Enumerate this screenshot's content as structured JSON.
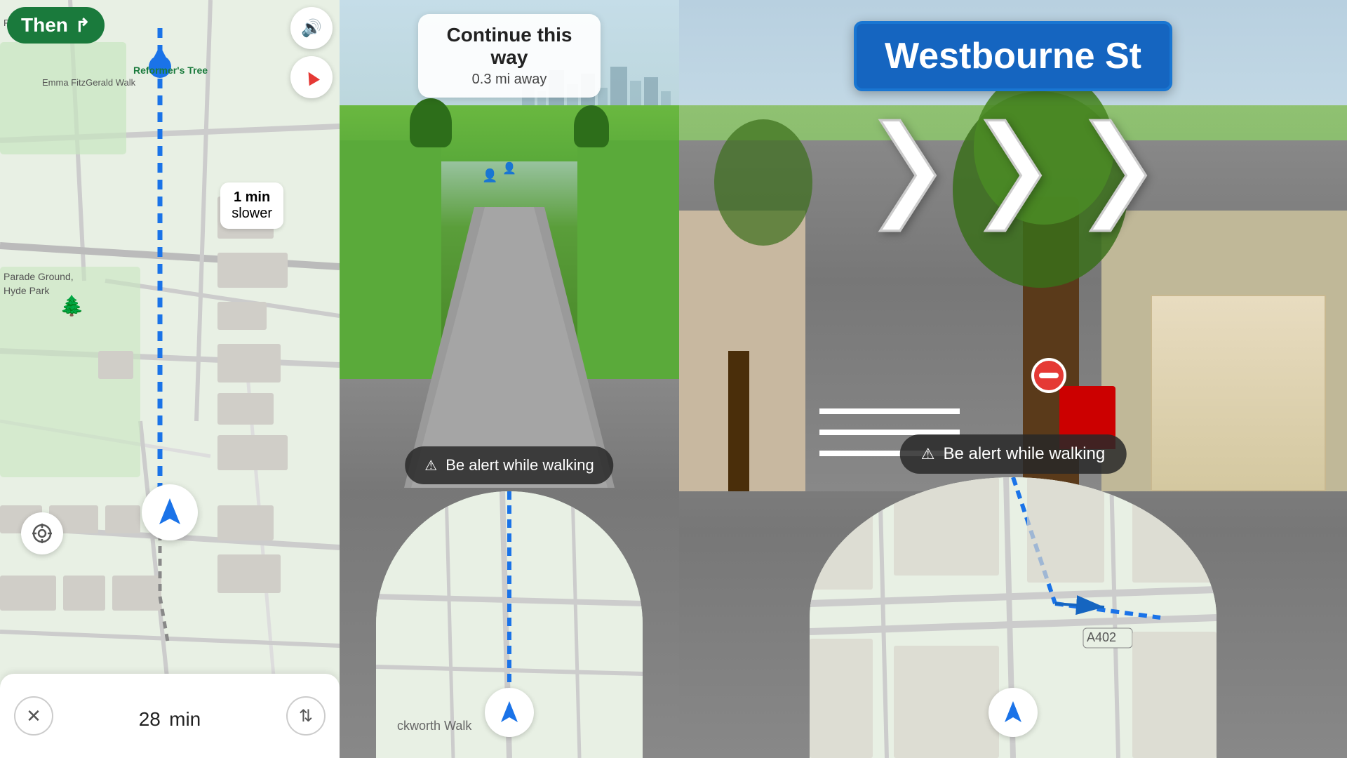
{
  "left": {
    "then_label": "Then",
    "then_arrow": "↱",
    "sound_icon": "🔊",
    "compass_icon": "▲",
    "slower_label": "1 min",
    "slower_sub": "slower",
    "time_label": "28",
    "time_unit": "min",
    "map_label1": "Reformer's Tree",
    "map_label2": "Emma FitzGerald Walk",
    "map_label3": "Hyde Park",
    "map_label4": "Parade Ground,",
    "map_label5": "Hyde Park",
    "map_label6": "Park Toilets",
    "map_label7": "Rckworth Walk"
  },
  "middle": {
    "continue_title": "Continue this way",
    "continue_sub": "0.3 mi away",
    "alert_label": "Be alert while walking"
  },
  "right": {
    "street_name": "Westbourne St",
    "alert_label": "Be alert while walking",
    "road_label": "A402"
  },
  "icons": {
    "alert": "⚠",
    "close": "✕",
    "route_options": "⇅",
    "location": "⊙"
  },
  "colors": {
    "map_green": "#e8f0e4",
    "route_blue": "#1a73e8",
    "nav_green": "#1a7a3c",
    "street_sign_blue": "#1565c0",
    "alert_bg": "rgba(40,40,40,0.85)"
  }
}
